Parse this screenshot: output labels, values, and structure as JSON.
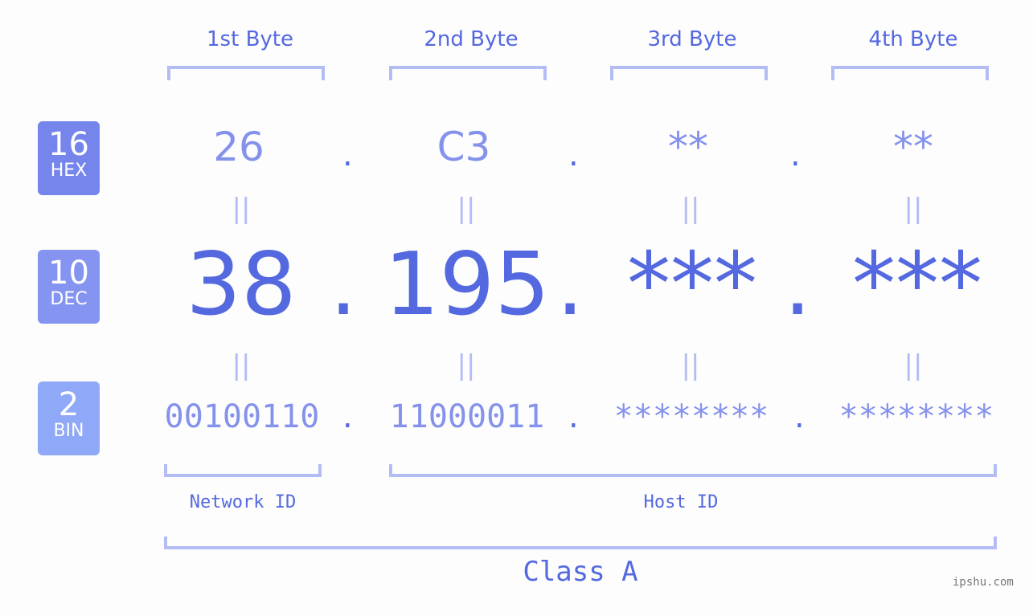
{
  "headers": [
    "1st Byte",
    "2nd Byte",
    "3rd Byte",
    "4th Byte"
  ],
  "badges": [
    {
      "num": "16",
      "label": "HEX",
      "color": "#7585ec"
    },
    {
      "num": "10",
      "label": "DEC",
      "color": "#8593f1"
    },
    {
      "num": "2",
      "label": "BIN",
      "color": "#90a8f8"
    }
  ],
  "hex": [
    "26",
    "C3",
    "**",
    "**"
  ],
  "dec": [
    "38",
    "195",
    "***",
    "***"
  ],
  "bin": [
    "00100110",
    "11000011",
    "********",
    "********"
  ],
  "separator": ".",
  "equals": "||",
  "network_label": "Network ID",
  "host_label": "Host ID",
  "class_label": "Class A",
  "watermark": "ipshu.com"
}
